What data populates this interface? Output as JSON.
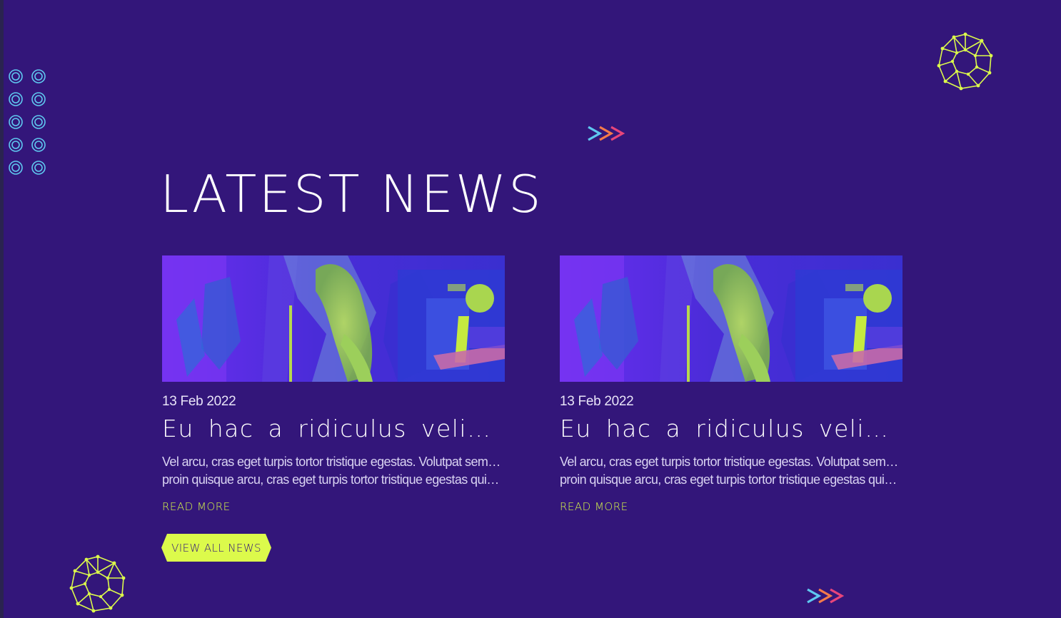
{
  "section": {
    "title": "LATEST NEWS"
  },
  "articles": [
    {
      "date": "13 Feb 2022",
      "headline": "Eu hac a ridiculus velit, ma...",
      "excerpt_line1": "Vel arcu, cras eget turpis tortor tristique egestas. Volutpat semper",
      "excerpt_line2": "proin quisque arcu, cras eget turpis tortor tristique egestas quisqu...",
      "read_more": "READ MORE"
    },
    {
      "date": "13 Feb 2022",
      "headline": "Eu hac a ridiculus velit, ma...",
      "excerpt_line1": "Vel arcu, cras eget turpis tortor tristique egestas. Volutpat semper",
      "excerpt_line2": "proin quisque arcu, cras eget turpis tortor tristique egestas quisqu...",
      "read_more": "READ MORE"
    }
  ],
  "actions": {
    "view_all": "VIEW ALL NEWS"
  },
  "colors": {
    "background": "#33167a",
    "accent": "#dcfa4b",
    "ring_blue": "#5fc8f0",
    "chevron_blue": "#5fc8f0",
    "chevron_orange": "#f47a4a",
    "chevron_pink": "#e8457a"
  },
  "icons": {
    "decor_dots": "concentric-ring-icon",
    "network": "network-polygon-icon",
    "chevrons": "triple-chevron-icon"
  }
}
